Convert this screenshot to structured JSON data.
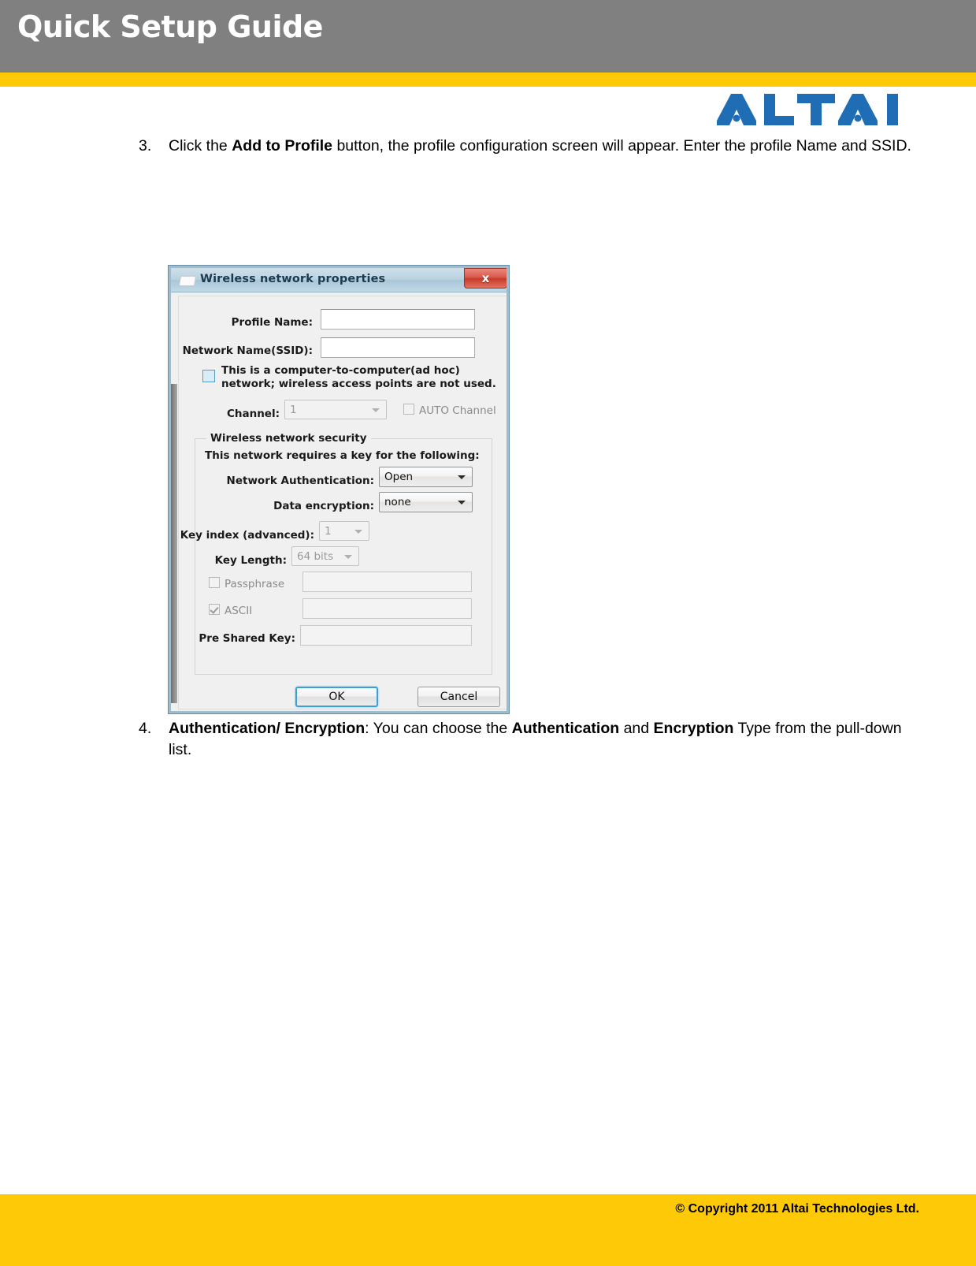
{
  "header": {
    "title": "Quick Setup Guide",
    "accent_color": "#fec907",
    "band_color": "#808080"
  },
  "logo": {
    "name": "ALTAI",
    "color": "#1f6eb5"
  },
  "steps": [
    {
      "number": "3.",
      "text_parts": [
        {
          "text": "Click the ",
          "bold": false
        },
        {
          "text": "Add to Profile",
          "bold": true
        },
        {
          "text": " button, the profile configuration screen will appear. Enter the profile Name and SSID.",
          "bold": false
        }
      ]
    },
    {
      "number": "4.",
      "text_parts": [
        {
          "text": "Authentication/ Encryption",
          "bold": true
        },
        {
          "text": ": You can choose the ",
          "bold": false
        },
        {
          "text": "Authentication",
          "bold": true
        },
        {
          "text": " and ",
          "bold": false
        },
        {
          "text": "Encryption",
          "bold": true
        },
        {
          "text": " Type from the pull-down list.",
          "bold": false
        }
      ]
    }
  ],
  "dialog": {
    "title": "Wireless network properties",
    "close_label": "x",
    "fields": {
      "profile_name_label": "Profile Name:",
      "profile_name_value": "",
      "ssid_label": "Network Name(SSID):",
      "ssid_value": "",
      "adhoc_checkbox_label": "This is a computer-to-computer(ad hoc) network; wireless access points are not used.",
      "adhoc_checked": false,
      "channel_label": "Channel:",
      "channel_value": "1",
      "auto_channel_label": "AUTO Channel",
      "auto_channel_checked": false
    },
    "security": {
      "group_title": "Wireless network security",
      "subtitle": "This network requires a key for the following:",
      "auth_label": "Network Authentication:",
      "auth_value": "Open",
      "encryption_label": "Data encryption:",
      "encryption_value": "none",
      "key_index_label": "Key index (advanced):",
      "key_index_value": "1",
      "key_length_label": "Key Length:",
      "key_length_value": "64 bits",
      "passphrase_label": "Passphrase",
      "passphrase_checked": false,
      "passphrase_value": "",
      "ascii_label": "ASCII",
      "ascii_checked": true,
      "ascii_value": "",
      "psk_label": "Pre Shared Key:",
      "psk_value": ""
    },
    "buttons": {
      "ok": "OK",
      "cancel": "Cancel"
    }
  },
  "footer": {
    "copyright": "© Copyright 2011 Altai Technologies Ltd.",
    "band_color": "#fec907"
  }
}
